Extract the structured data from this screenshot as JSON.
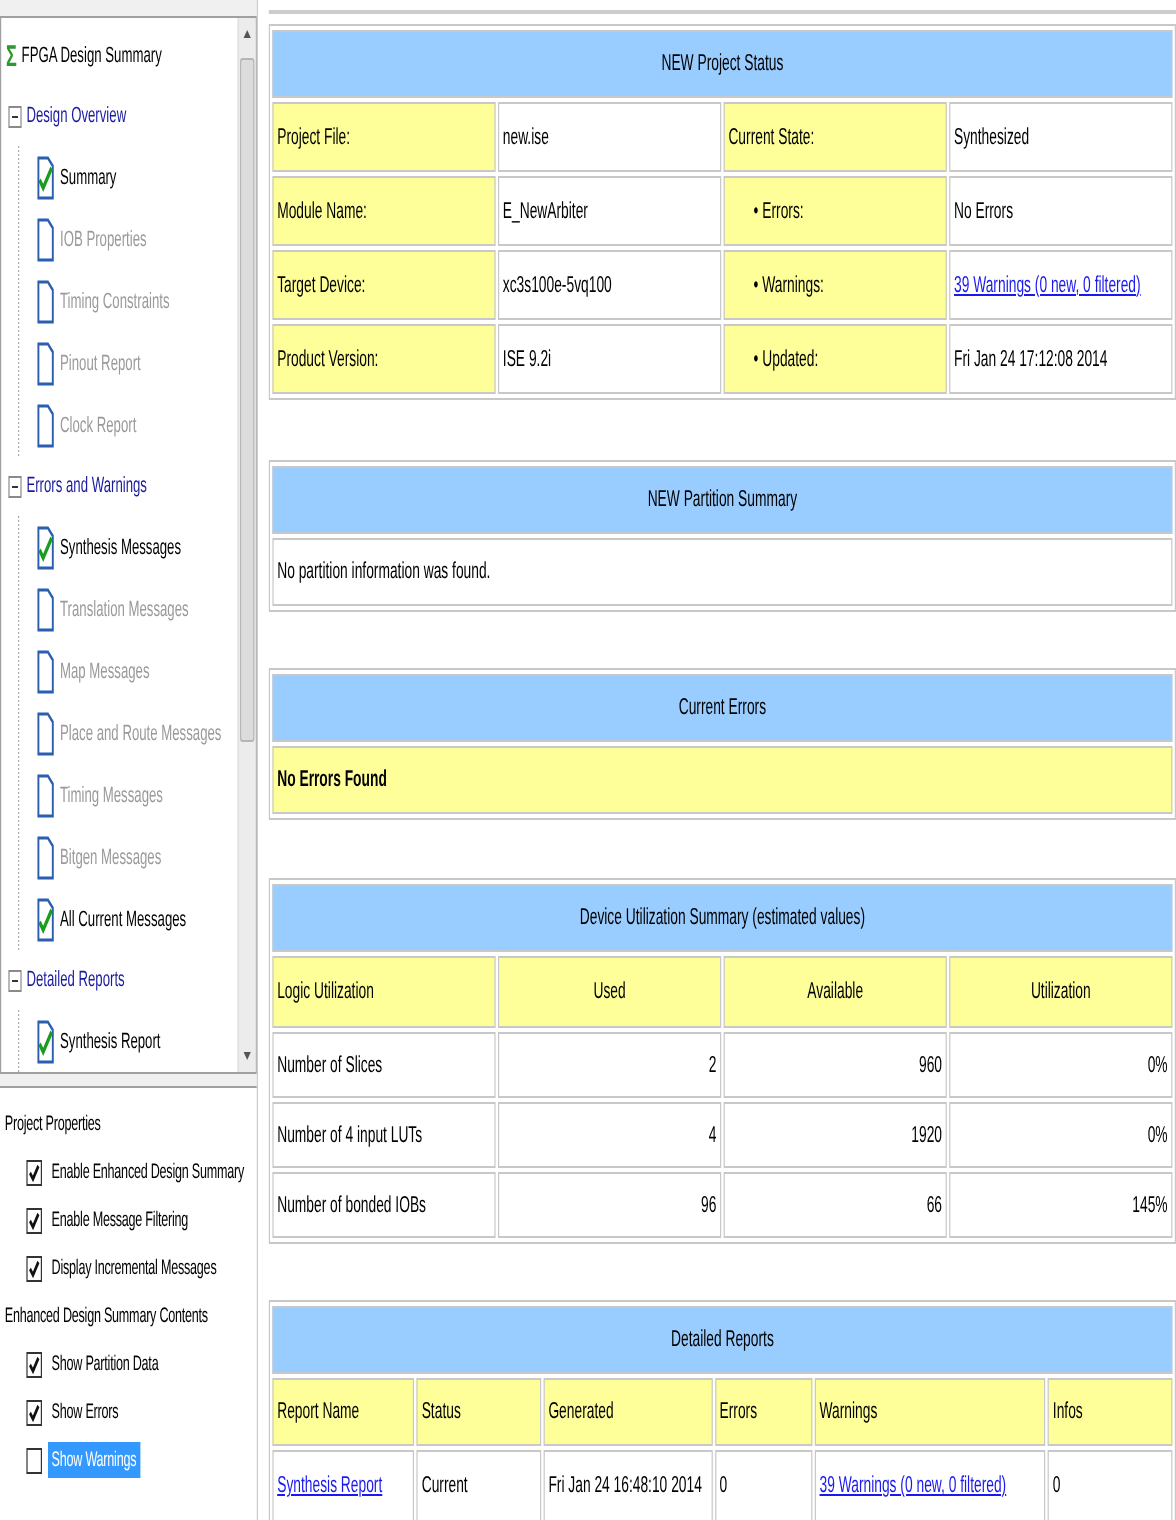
{
  "design_summary": {
    "icon": "Σ",
    "title": "FPGA Design Summary",
    "groups": [
      {
        "label": "Design Overview",
        "expanded": true,
        "children": [
          {
            "label": "Summary",
            "checked": true
          },
          {
            "label": "IOB Properties",
            "checked": false
          },
          {
            "label": "Timing Constraints",
            "checked": false
          },
          {
            "label": "Pinout Report",
            "checked": false
          },
          {
            "label": "Clock Report",
            "checked": false
          }
        ]
      },
      {
        "label": "Errors and Warnings",
        "expanded": true,
        "children": [
          {
            "label": "Synthesis Messages",
            "checked": true
          },
          {
            "label": "Translation Messages",
            "checked": false
          },
          {
            "label": "Map Messages",
            "checked": false
          },
          {
            "label": "Place and Route Messages",
            "checked": false
          },
          {
            "label": "Timing Messages",
            "checked": false
          },
          {
            "label": "Bitgen Messages",
            "checked": false
          },
          {
            "label": "All Current Messages",
            "checked": true
          }
        ]
      },
      {
        "label": "Detailed Reports",
        "expanded": true,
        "children": [
          {
            "label": "Synthesis Report",
            "checked": true
          }
        ]
      }
    ]
  },
  "properties": {
    "sections": [
      {
        "label": "Project Properties",
        "options": [
          {
            "label": "Enable Enhanced Design Summary",
            "checked": true,
            "selected": false
          },
          {
            "label": "Enable Message Filtering",
            "checked": true,
            "selected": false
          },
          {
            "label": "Display Incremental Messages",
            "checked": true,
            "selected": false
          }
        ]
      },
      {
        "label": "Enhanced Design Summary Contents",
        "options": [
          {
            "label": "Show Partition Data",
            "checked": true,
            "selected": false
          },
          {
            "label": "Show Errors",
            "checked": true,
            "selected": false
          },
          {
            "label": "Show Warnings",
            "checked": false,
            "selected": true
          }
        ]
      }
    ]
  },
  "report": [
    {
      "kind": "status",
      "title": "NEW Project Status",
      "rows": [
        {
          "label": "Project File:",
          "value": "new.ise",
          "label_2": "Current State:",
          "sub_2": false,
          "value_2": "Synthesized",
          "link_2": false
        },
        {
          "label": "Module Name:",
          "value": "E_NewArbiter",
          "label_2": "• Errors:",
          "sub_2": true,
          "value_2": "No Errors",
          "link_2": false
        },
        {
          "label": "Target Device:",
          "value": "xc3s100e-5vq100",
          "label_2": "• Warnings:",
          "sub_2": true,
          "value_2": "39 Warnings (0 new, 0 filtered)",
          "link_2": true
        },
        {
          "label": "Product Version:",
          "value": "ISE 9.2i",
          "label_2": "• Updated:",
          "sub_2": true,
          "value_2": "Fri Jan 24 17:12:08 2014",
          "link_2": false
        }
      ]
    },
    {
      "kind": "message",
      "title": "NEW Partition Summary",
      "text": "No partition information was found."
    },
    {
      "kind": "notice",
      "title": "Current Errors",
      "text": "No Errors Found"
    },
    {
      "kind": "numeric_table",
      "title": "Device Utilization Summary (estimated values)",
      "columns": [
        "Logic Utilization",
        "Used",
        "Available",
        "Utilization"
      ],
      "rows": [
        [
          "Number of Slices",
          "2",
          "960",
          "0%"
        ],
        [
          "Number of 4 input LUTs",
          "4",
          "1920",
          "0%"
        ],
        [
          "Number of bonded IOBs",
          "96",
          "66",
          "145%"
        ]
      ]
    },
    {
      "kind": "report_table",
      "title": "Detailed Reports",
      "columns": [
        "Report Name",
        "Status",
        "Generated",
        "Errors",
        "Warnings",
        "Infos"
      ],
      "rows": [
        [
          {
            "text": "Synthesis Report",
            "link": true
          },
          {
            "text": "Current",
            "link": false
          },
          {
            "text": "Fri Jan 24 16:48:10 2014",
            "link": false
          },
          {
            "text": "0",
            "link": false
          },
          {
            "text": "39 Warnings (0 new, 0 filtered)",
            "link": true
          },
          {
            "text": "0",
            "link": false
          }
        ]
      ]
    }
  ]
}
